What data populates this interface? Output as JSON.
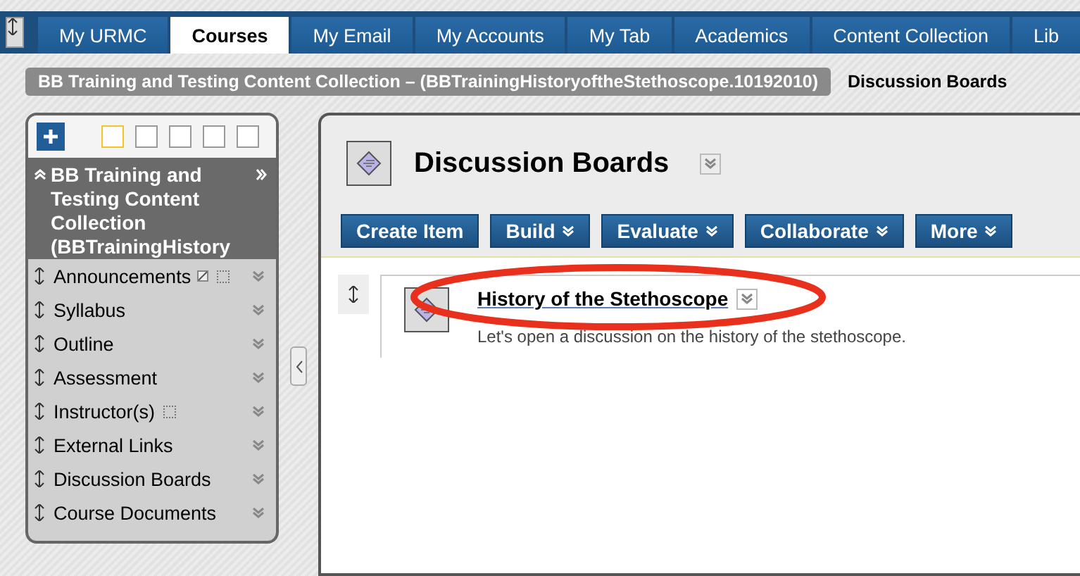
{
  "tabs": [
    {
      "label": "My URMC",
      "selected": false
    },
    {
      "label": "Courses",
      "selected": true
    },
    {
      "label": "My Email",
      "selected": false
    },
    {
      "label": "My Accounts",
      "selected": false
    },
    {
      "label": "My Tab",
      "selected": false
    },
    {
      "label": "Academics",
      "selected": false
    },
    {
      "label": "Content Collection",
      "selected": false
    },
    {
      "label": "Lib",
      "selected": false
    }
  ],
  "breadcrumb": {
    "course": "BB Training and Testing Content Collection – (BBTrainingHistoryoftheStethoscope.10192010)",
    "page": "Discussion Boards"
  },
  "sidebar": {
    "title": "BB Training and Testing Content Collection (BBTrainingHistory",
    "items": [
      {
        "label": "Announcements",
        "kind": "hidden-edit"
      },
      {
        "label": "Syllabus",
        "kind": "plain"
      },
      {
        "label": "Outline",
        "kind": "plain"
      },
      {
        "label": "Assessment",
        "kind": "plain"
      },
      {
        "label": "Instructor(s)",
        "kind": "hidden"
      },
      {
        "label": "External Links",
        "kind": "plain"
      },
      {
        "label": "Discussion Boards",
        "kind": "plain"
      },
      {
        "label": "Course Documents",
        "kind": "plain"
      }
    ]
  },
  "page_title": "Discussion Boards",
  "action_buttons": [
    {
      "label": "Create Item",
      "kind": "plain"
    },
    {
      "label": "Build",
      "kind": "menu"
    },
    {
      "label": "Evaluate",
      "kind": "menu"
    },
    {
      "label": "Collaborate",
      "kind": "menu"
    },
    {
      "label": "More",
      "kind": "menu"
    }
  ],
  "content_items": [
    {
      "title": "History of the Stethoscope",
      "description": "Let's open a discussion on the history of the stethoscope.",
      "highlighted": true
    }
  ]
}
